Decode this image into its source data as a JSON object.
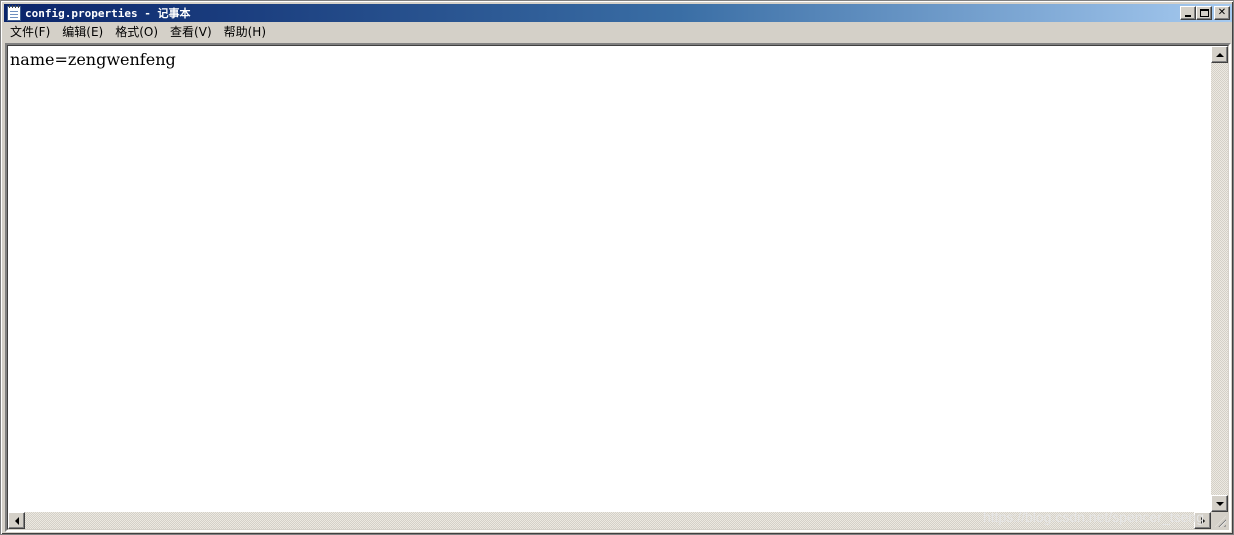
{
  "window": {
    "title": "config.properties - 记事本"
  },
  "menu": [
    {
      "label": "文件(F)"
    },
    {
      "label": "编辑(E)"
    },
    {
      "label": "格式(O)"
    },
    {
      "label": "查看(V)"
    },
    {
      "label": "帮助(H)"
    }
  ],
  "editor": {
    "content": "name=zengwenfeng"
  },
  "watermark": "https://blog.csdn.net/spencer_tseng",
  "colors": {
    "title_gradient_start": "#0a246a",
    "title_gradient_end": "#a6caf0",
    "chrome": "#d4d0c8",
    "editor_bg": "#ffffff"
  },
  "icons": {
    "app": "notepad-icon",
    "minimize": "minimize-icon",
    "maximize": "maximize-icon",
    "close": "close-icon"
  }
}
